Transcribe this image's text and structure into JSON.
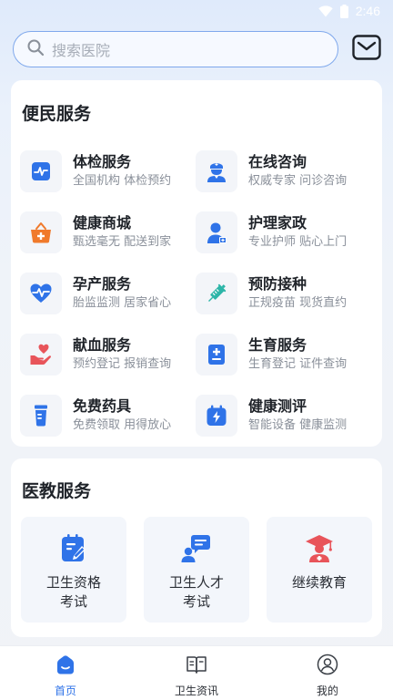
{
  "status_bar": {
    "time": "2:46",
    "icons": [
      "wifi-icon",
      "battery-icon"
    ]
  },
  "search": {
    "placeholder": "搜索医院",
    "icon": "search-icon"
  },
  "header": {
    "message_icon": "mail-icon"
  },
  "convenience": {
    "title": "便民服务",
    "items": [
      {
        "title": "体检服务",
        "subtitle": "全国机构 体检预约",
        "icon": "pulse-icon",
        "color": "#2f73e8"
      },
      {
        "title": "在线咨询",
        "subtitle": "权威专家 问诊咨询",
        "icon": "doctor-icon",
        "color": "#2f73e8"
      },
      {
        "title": "健康商城",
        "subtitle": "甄选毫无 配送到家",
        "icon": "basket-icon",
        "color": "#f07a2c"
      },
      {
        "title": "护理家政",
        "subtitle": "专业护师 贴心上门",
        "icon": "nurse-icon",
        "color": "#2f73e8"
      },
      {
        "title": "孕产服务",
        "subtitle": "胎监监测 居家省心",
        "icon": "heart-pulse-icon",
        "color": "#2f73e8"
      },
      {
        "title": "预防接种",
        "subtitle": "正规疫苗 现货直约",
        "icon": "syringe-icon",
        "color": "#2cb5a8"
      },
      {
        "title": "献血服务",
        "subtitle": "预约登记 报销查询",
        "icon": "blood-donation-icon",
        "color": "#e8545a"
      },
      {
        "title": "生育服务",
        "subtitle": "生育登记 证件查询",
        "icon": "medical-card-icon",
        "color": "#2f73e8"
      },
      {
        "title": "免费药具",
        "subtitle": "免费领取 用得放心",
        "icon": "pill-bottle-icon",
        "color": "#2f73e8"
      },
      {
        "title": "健康测评",
        "subtitle": "智能设备 健康监测",
        "icon": "calendar-bolt-icon",
        "color": "#2f73e8"
      }
    ]
  },
  "education": {
    "title": "医教服务",
    "tiles": [
      {
        "label": "卫生资格考试",
        "icon": "exam-icon",
        "color": "#2f73e8"
      },
      {
        "label": "卫生人才考试",
        "icon": "talent-icon",
        "color": "#2f73e8"
      },
      {
        "label": "继续教育",
        "icon": "graduation-icon",
        "color": "#e8545a"
      }
    ]
  },
  "bottom_nav": {
    "items": [
      {
        "label": "首页",
        "icon": "home-icon",
        "active": true
      },
      {
        "label": "卫生资讯",
        "icon": "book-icon",
        "active": false
      },
      {
        "label": "我的",
        "icon": "user-icon",
        "active": false
      }
    ],
    "active_color": "#2f73e8"
  }
}
